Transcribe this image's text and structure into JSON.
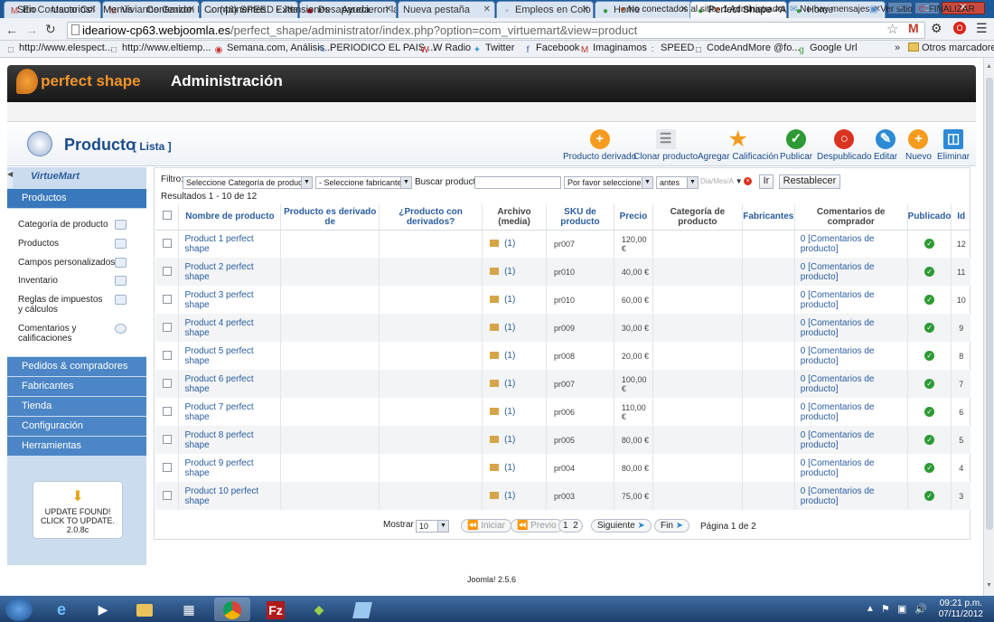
{
  "browser": {
    "tabs": [
      {
        "label": "En Contacto Col",
        "icon": "gmail-icon"
      },
      {
        "label": "Vivianne Garzon I",
        "icon": "gmail-icon"
      },
      {
        "label": "(46) SPEED - Juan",
        "icon": "speed-icon"
      },
      {
        "label": "Desaparecieron la",
        "icon": "news-icon"
      },
      {
        "label": "Nueva pestaña",
        "icon": ""
      },
      {
        "label": "Empleos en Colo",
        "icon": "page-icon"
      },
      {
        "label": "Home",
        "icon": "leaf-icon"
      },
      {
        "label": "Perfect Shape - A",
        "icon": "leaf-icon"
      },
      {
        "label": "Home",
        "icon": "leaf-icon"
      }
    ],
    "url_host": "ideariow-cp63.webjoomla.es",
    "url_path": "/perfect_shape/administrator/index.php?option=com_virtuemart&view=product",
    "bookmarks": [
      "http://www.elespect...",
      "http://www.eltiemp...",
      "Semana.com, Análisis...",
      "PERIODICO EL PAIS ...",
      "W Radio",
      "Twitter",
      "Facebook",
      "Imaginamos",
      "SPEED",
      "CodeAndMore @fo...",
      "Google Url"
    ],
    "other_bookmarks": "Otros marcadores"
  },
  "header": {
    "brand": "perfect shape",
    "title": "Administración"
  },
  "menu": {
    "items": [
      "Sitio",
      "Usuarios",
      "Menús",
      "Contenido",
      "Componentes",
      "Extensiones",
      "Ayuda"
    ],
    "status": {
      "offline": "No conectados al sitio",
      "admins": "1 Administrador",
      "messages": "No hay mensajes",
      "view_site": "Ver sitio",
      "logout": "FINALIZAR"
    }
  },
  "titlebar": {
    "title": "Producto",
    "subtitle": "[ Lista ]",
    "actions": [
      "Producto derivado",
      "Clonar producto",
      "Agregar Calificación",
      "Publicar",
      "Despublicado",
      "Editar",
      "Nuevo",
      "Eliminar"
    ]
  },
  "sidebar": {
    "logo": "VirtueMart",
    "current": "Productos",
    "items": [
      "Categoría de producto",
      "Productos",
      "Campos personalizados",
      "Inventario",
      "Reglas de impuestos y cálculos",
      "Comentarios y calificaciones"
    ],
    "sections": [
      "Pedidos & compradores",
      "Fabricantes",
      "Tienda",
      "Configuración",
      "Herramientas"
    ],
    "update": "UPDATE FOUND! CLICK TO UPDATE.",
    "version": "2.0.8c"
  },
  "filters": {
    "label": "Filtro:",
    "category": "Seleccione Categoría de producto",
    "manufacturer": "- Seleccione fabricante -",
    "search_label": "Buscar producto",
    "search_value": "",
    "date_select": "Por favor seleccione",
    "when": "antes",
    "date_placeholder": "Dia/Mes/A",
    "go": "Ir",
    "reset": "Restablecer"
  },
  "results": "Resultados 1 - 10 de 12",
  "columns": [
    "Nombre de producto",
    "Producto es derivado de",
    "¿Producto con derivados?",
    "Archivo (media)",
    "SKU de producto",
    "Precio",
    "Categoría de producto",
    "Fabricantes",
    "Comentarios de comprador",
    "Publicado",
    "Id"
  ],
  "rows": [
    {
      "name": "Product 1 perfect shape",
      "media": "(1)",
      "sku": "pr007",
      "price": "120,00 €",
      "comments": "0 [Comentarios de producto]",
      "id": "12"
    },
    {
      "name": "Product 2 perfect shape",
      "media": "(1)",
      "sku": "pr010",
      "price": "40,00 €",
      "comments": "0 [Comentarios de producto]",
      "id": "11"
    },
    {
      "name": "Product 3 perfect shape",
      "media": "(1)",
      "sku": "pr010",
      "price": "60,00 €",
      "comments": "0 [Comentarios de producto]",
      "id": "10"
    },
    {
      "name": "Product 4 perfect shape",
      "media": "(1)",
      "sku": "pr009",
      "price": "30,00 €",
      "comments": "0 [Comentarios de producto]",
      "id": "9"
    },
    {
      "name": "Product 5 perfect shape",
      "media": "(1)",
      "sku": "pr008",
      "price": "20,00 €",
      "comments": "0 [Comentarios de producto]",
      "id": "8"
    },
    {
      "name": "Product 6 perfect shape",
      "media": "(1)",
      "sku": "pr007",
      "price": "100,00 €",
      "comments": "0 [Comentarios de producto]",
      "id": "7"
    },
    {
      "name": "Product 7 perfect shape",
      "media": "(1)",
      "sku": "pr006",
      "price": "110,00 €",
      "comments": "0 [Comentarios de producto]",
      "id": "6"
    },
    {
      "name": "Product 8 perfect shape",
      "media": "(1)",
      "sku": "pr005",
      "price": "80,00 €",
      "comments": "0 [Comentarios de producto]",
      "id": "5"
    },
    {
      "name": "Product 9 perfect shape",
      "media": "(1)",
      "sku": "pr004",
      "price": "80,00 €",
      "comments": "0 [Comentarios de producto]",
      "id": "4"
    },
    {
      "name": "Product 10 perfect shape",
      "media": "(1)",
      "sku": "pr003",
      "price": "75,00 €",
      "comments": "0 [Comentarios de producto]",
      "id": "3"
    }
  ],
  "pager": {
    "show_label": "Mostrar #",
    "limit": "10",
    "first": "Iniciar",
    "prev": "Previo",
    "pages": [
      "1",
      "2"
    ],
    "next": "Siguiente",
    "last": "Fin",
    "info": "Página 1 de 2"
  },
  "footer": "Joomla! 2.5.6",
  "taskbar": {
    "time": "09:21 p.m.",
    "date": "07/11/2012"
  },
  "colors": {
    "accent": "#4c86c6",
    "header": "#1a4c8c",
    "ok": "#2e9a35"
  }
}
